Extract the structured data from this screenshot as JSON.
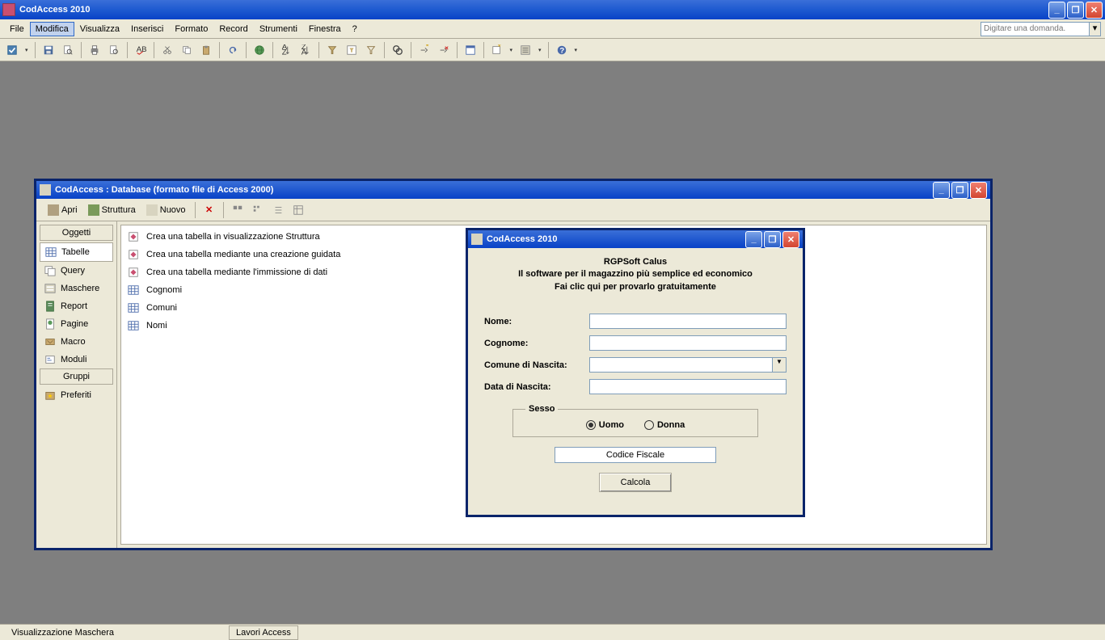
{
  "app": {
    "title": "CodAccess 2010"
  },
  "menu": {
    "items": [
      "File",
      "Modifica",
      "Visualizza",
      "Inserisci",
      "Formato",
      "Record",
      "Strumenti",
      "Finestra",
      "?"
    ],
    "activeIndex": 1,
    "searchPlaceholder": "Digitare una domanda."
  },
  "dbWindow": {
    "title": "CodAccess : Database (formato file di Access 2000)",
    "toolbar": {
      "open": "Apri",
      "design": "Struttura",
      "new": "Nuovo"
    },
    "sections": {
      "objects": "Oggetti",
      "groups": "Gruppi"
    },
    "sidebar": [
      {
        "label": "Tabelle",
        "selected": true
      },
      {
        "label": "Query"
      },
      {
        "label": "Maschere"
      },
      {
        "label": "Report"
      },
      {
        "label": "Pagine"
      },
      {
        "label": "Macro"
      },
      {
        "label": "Moduli"
      }
    ],
    "favorites": "Preferiti",
    "list": [
      {
        "label": "Crea una tabella in visualizzazione Struttura",
        "kind": "action"
      },
      {
        "label": "Crea una tabella mediante una creazione guidata",
        "kind": "action"
      },
      {
        "label": "Crea una tabella mediante l'immissione di dati",
        "kind": "action"
      },
      {
        "label": "Cognomi",
        "kind": "table"
      },
      {
        "label": "Comuni",
        "kind": "table"
      },
      {
        "label": "Nomi",
        "kind": "table"
      }
    ]
  },
  "dialog": {
    "title": "CodAccess 2010",
    "ad": {
      "line1": "RGPSoft Calus",
      "line2": "Il software per il magazzino più semplice ed economico",
      "line3": "Fai clic qui per provarlo gratuitamente"
    },
    "fields": {
      "nome": {
        "label": "Nome:",
        "value": ""
      },
      "cognome": {
        "label": "Cognome:",
        "value": ""
      },
      "comune": {
        "label": "Comune di Nascita:",
        "value": ""
      },
      "data": {
        "label": "Data di Nascita:",
        "value": ""
      }
    },
    "sesso": {
      "legend": "Sesso",
      "uomo": "Uomo",
      "donna": "Donna",
      "selected": "uomo"
    },
    "cfLabel": "Codice Fiscale",
    "calcola": "Calcola"
  },
  "statusbar": {
    "mode": "Visualizzazione Maschera",
    "task": "Lavori Access"
  }
}
